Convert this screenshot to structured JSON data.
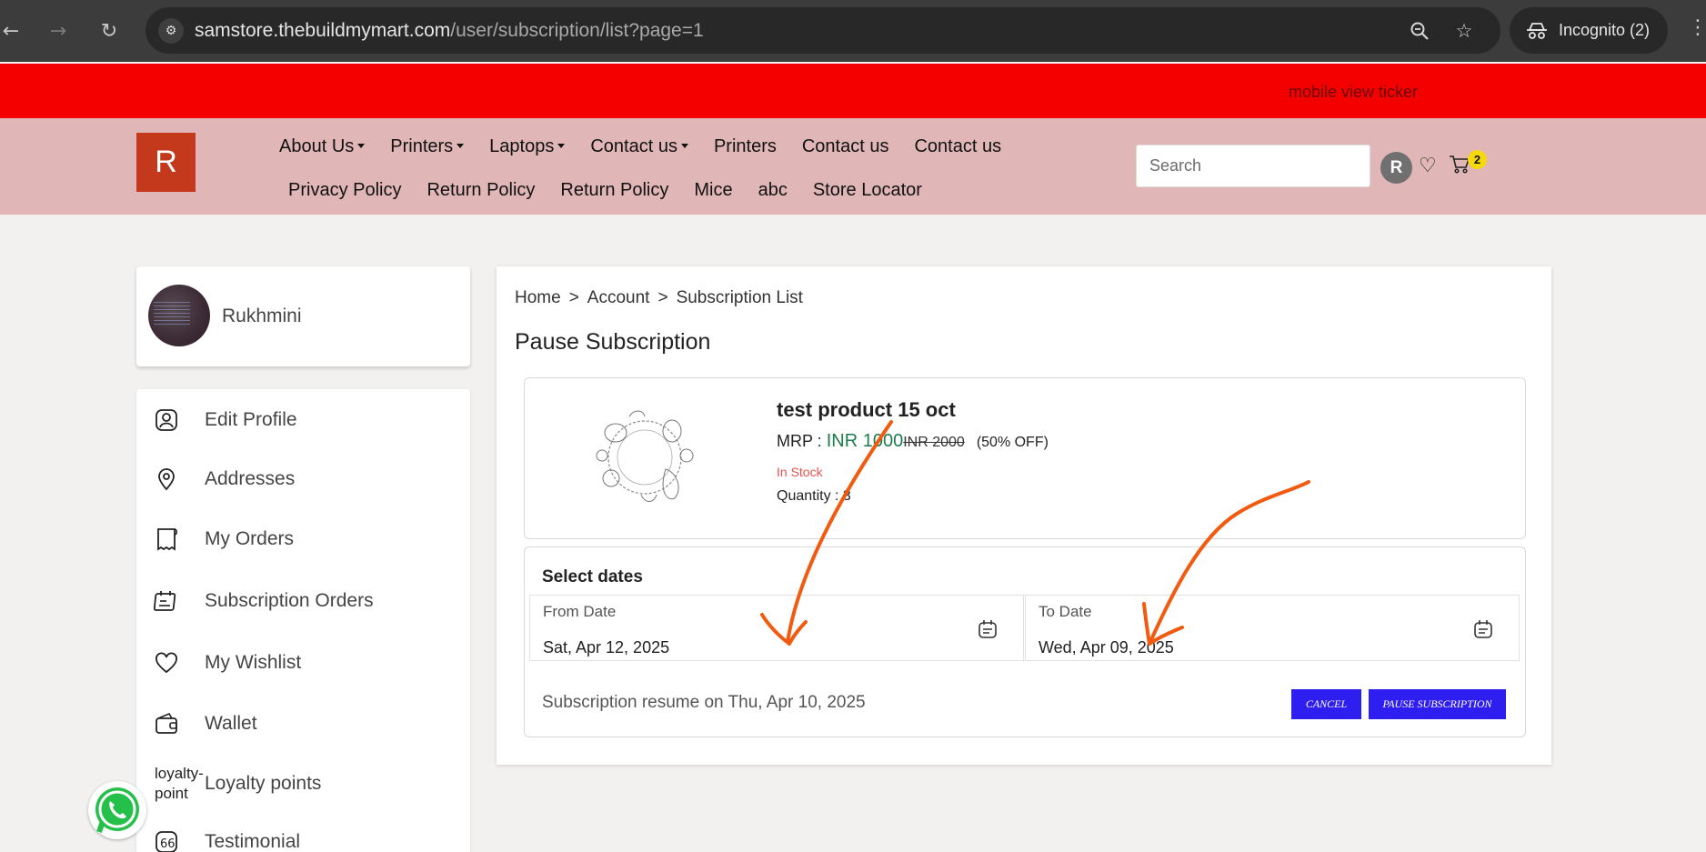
{
  "browser": {
    "url_host": "samstore.thebuildmymart.com",
    "url_path": "/user/subscription/list?page=1",
    "profile_label": "Incognito (2)"
  },
  "ticker": {
    "text": "mobile view ticker"
  },
  "header": {
    "logo_letter": "R",
    "nav_row1": [
      {
        "label": "About Us",
        "dropdown": true
      },
      {
        "label": "Printers",
        "dropdown": true
      },
      {
        "label": "Laptops",
        "dropdown": true
      },
      {
        "label": "Contact us",
        "dropdown": true
      },
      {
        "label": "Printers",
        "dropdown": false
      },
      {
        "label": "Contact us",
        "dropdown": false
      },
      {
        "label": "Contact us",
        "dropdown": false
      }
    ],
    "nav_row2": [
      {
        "label": "Privacy Policy"
      },
      {
        "label": "Return Policy"
      },
      {
        "label": "Return Policy"
      },
      {
        "label": "Mice"
      },
      {
        "label": "abc"
      },
      {
        "label": "Store Locator"
      }
    ],
    "search_placeholder": "Search",
    "avatar_letter": "R",
    "cart_count": "2"
  },
  "profile": {
    "name": "Rukhmini"
  },
  "sidebar": {
    "items": [
      {
        "label": "Edit Profile",
        "icon": "user-icon"
      },
      {
        "label": "Addresses",
        "icon": "location-pin-icon"
      },
      {
        "label": "My Orders",
        "icon": "receipt-icon"
      },
      {
        "label": "Subscription Orders",
        "icon": "calendar-icon"
      },
      {
        "label": "My Wishlist",
        "icon": "heart-icon"
      },
      {
        "label": "Wallet",
        "icon": "wallet-icon"
      },
      {
        "label": "Loyalty points",
        "icon": "loyalty-point-image",
        "image_alt": "loyalty-point"
      },
      {
        "label": "Testimonial",
        "icon": "quote-icon"
      }
    ]
  },
  "main": {
    "breadcrumb": [
      "Home",
      ">",
      "Account",
      ">",
      "Subscription List"
    ],
    "title": "Pause Subscription",
    "product": {
      "name": "test product 15 oct",
      "mrp_label": "MRP :",
      "sale_price": "INR 1000",
      "mrp_price": "INR 2000",
      "discount": "(50% OFF)",
      "stock": "In Stock",
      "quantity": "Quantity : 3"
    },
    "dates": {
      "title": "Select dates",
      "from_label": "From Date",
      "from_value": "Sat, Apr 12, 2025",
      "to_label": "To Date",
      "to_value": "Wed, Apr 09, 2025",
      "resume_text": "Subscription resume on Thu, Apr 10, 2025",
      "cancel_label": "CANCEL",
      "pause_label": "PAUSE SUBSCRIPTION"
    }
  },
  "colors": {
    "ticker_bg": "#f40000",
    "header_bg": "#e0b6b7",
    "logo_bg": "#c4391c",
    "button_bg": "#2f1ef0",
    "price_green": "#1e7a4f",
    "stock_red": "#e8534d",
    "annotation_orange": "#f15a0f"
  }
}
